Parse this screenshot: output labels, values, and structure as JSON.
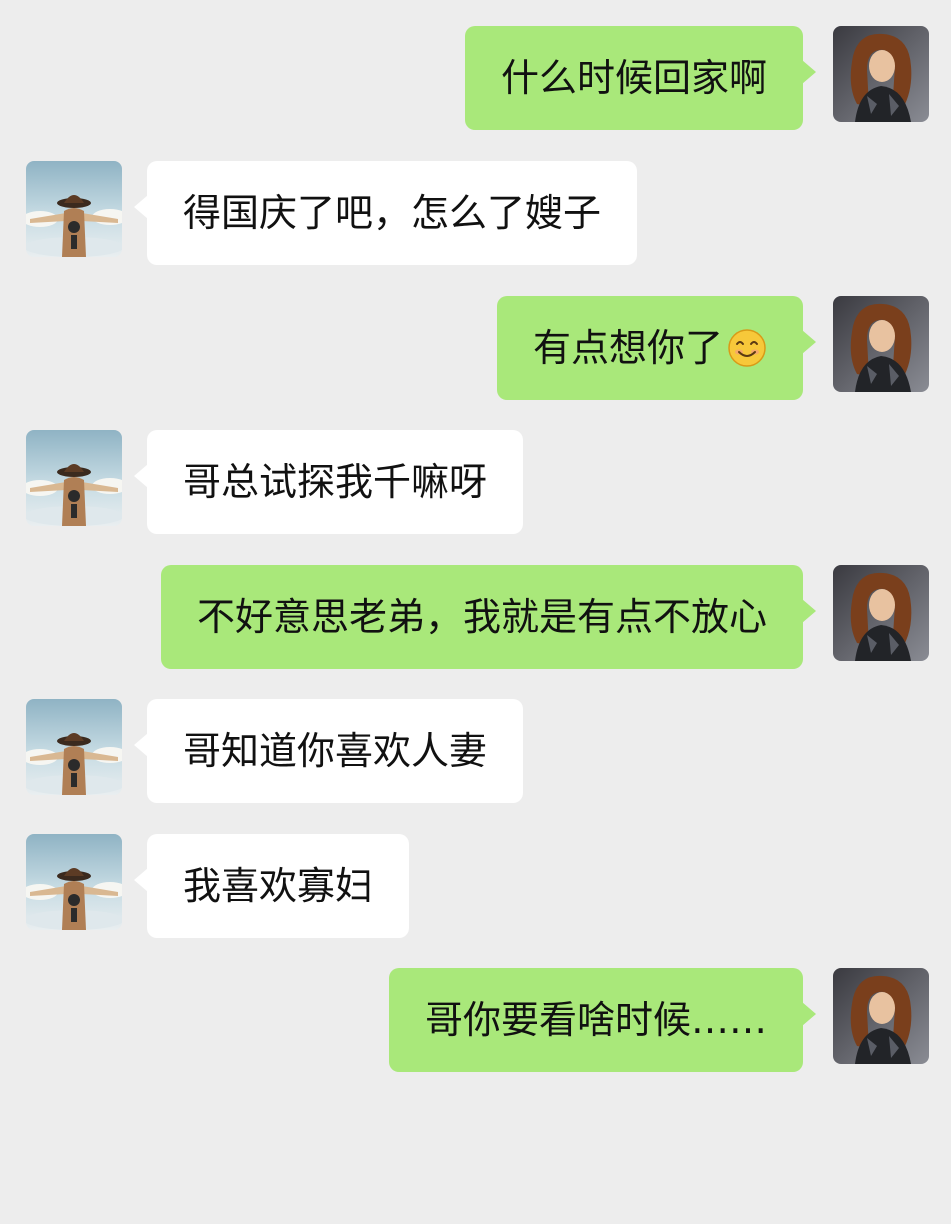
{
  "colors": {
    "background": "#ededed",
    "sent_bubble": "#a9e87a",
    "received_bubble": "#ffffff"
  },
  "messages": [
    {
      "sender": "me",
      "text": "什么时候回家啊"
    },
    {
      "sender": "friend",
      "text": "得国庆了吧，怎么了嫂子"
    },
    {
      "sender": "me",
      "text": "有点想你了",
      "emoji": "smiling-face-icon"
    },
    {
      "sender": "friend",
      "text": "哥总试探我千嘛呀"
    },
    {
      "sender": "me",
      "text": "不好意思老弟，我就是有点不放心"
    },
    {
      "sender": "friend",
      "text": "哥知道你喜欢人妻"
    },
    {
      "sender": "friend",
      "text": "我喜欢寡妇"
    },
    {
      "sender": "me",
      "text": "哥你要看啥时候……"
    }
  ]
}
